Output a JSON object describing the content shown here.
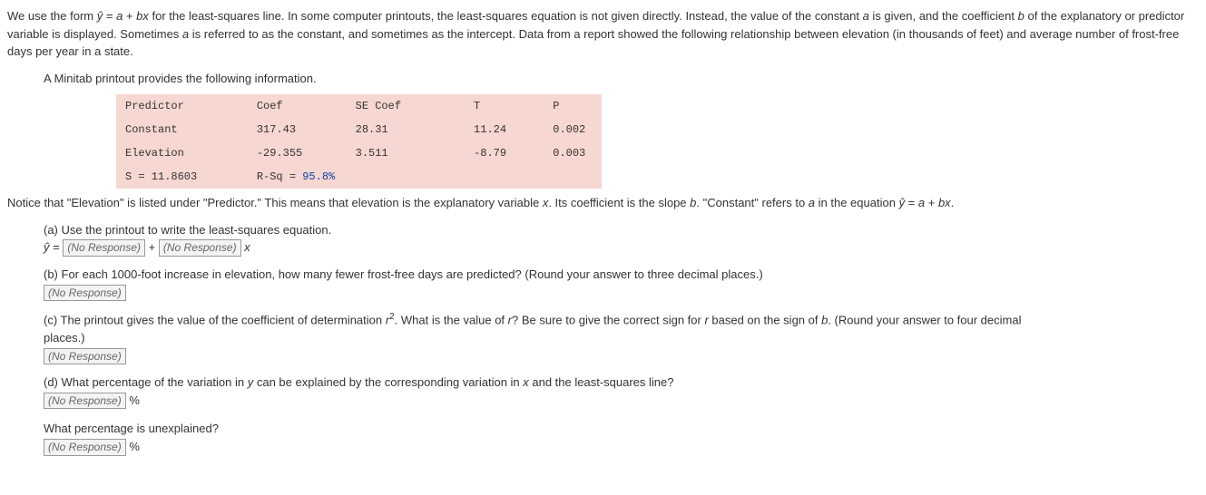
{
  "intro": {
    "line1_a": "We use the form ",
    "line1_b": "ŷ",
    "line1_c": " = ",
    "line1_d": "a",
    "line1_e": " + ",
    "line1_f": "bx",
    "line1_g": " for the least-squares line. In some computer printouts, the least-squares equation is not given directly. Instead, the value of the constant ",
    "line1_h": "a",
    "line1_i": " is given, and the coefficient ",
    "line1_j": "b",
    "line2_a": "of the explanatory or predictor variable is displayed. Sometimes ",
    "line2_b": "a",
    "line2_c": " is referred to as the constant, and sometimes as the intercept. Data from a report showed the following relationship between",
    "line3": "elevation (in thousands of feet) and average number of frost-free days per year in a state."
  },
  "sub_intro": "A Minitab printout provides the following information.",
  "table": {
    "headers": {
      "c1": "Predictor",
      "c2": "Coef",
      "c3": "SE Coef",
      "c4": "T",
      "c5": "P"
    },
    "row1": {
      "c1": "Constant",
      "c2": "317.43",
      "c3": "28.31",
      "c4": "11.24",
      "c5": "0.002"
    },
    "row2": {
      "c1": "Elevation",
      "c2": "-29.355",
      "c3": "3.511",
      "c4": "-8.79",
      "c5": "0.003"
    },
    "footer": {
      "s": "S = 11.8603",
      "rsq": "R-Sq = ",
      "rsq_val": "95.8%"
    }
  },
  "notice": {
    "a": "Notice that \"Elevation\" is listed under \"Predictor.\" This means that elevation is the explanatory variable ",
    "b": "x",
    "c": ". Its coefficient is the slope ",
    "d": "b",
    "e": ". \"Constant\" refers to ",
    "f": "a",
    "g": " in the equation ",
    "h": "ŷ",
    "i": " = ",
    "j": "a",
    "k": " + ",
    "l": "bx",
    "m": "."
  },
  "qa": {
    "prompt": "(a) Use the printout to write the least-squares equation.",
    "yhat": "ŷ",
    "eq": " = ",
    "plus": " + ",
    "x": " x"
  },
  "qb": {
    "prompt": "(b) For each 1000-foot increase in elevation, how many fewer frost-free days are predicted? (Round your answer to three decimal places.)"
  },
  "qc": {
    "p1": "(c) The printout gives the value of the coefficient of determination ",
    "r": "r",
    "sq": "2",
    "p2": ". What is the value of ",
    "r2": "r",
    "p3": "? Be sure to give the correct sign for ",
    "r3": "r",
    "p4": " based on the sign of ",
    "b": "b",
    "p5": ". (Round your answer to four decimal",
    "p6": "places.)"
  },
  "qd": {
    "p1": "(d) What percentage of the variation in ",
    "y": "y",
    "p2": " can be explained by the corresponding variation in ",
    "x": "x",
    "p3": " and the least-squares line?",
    "pct": " %",
    "p4": "What percentage is unexplained?"
  },
  "no_response": "(No Response)"
}
